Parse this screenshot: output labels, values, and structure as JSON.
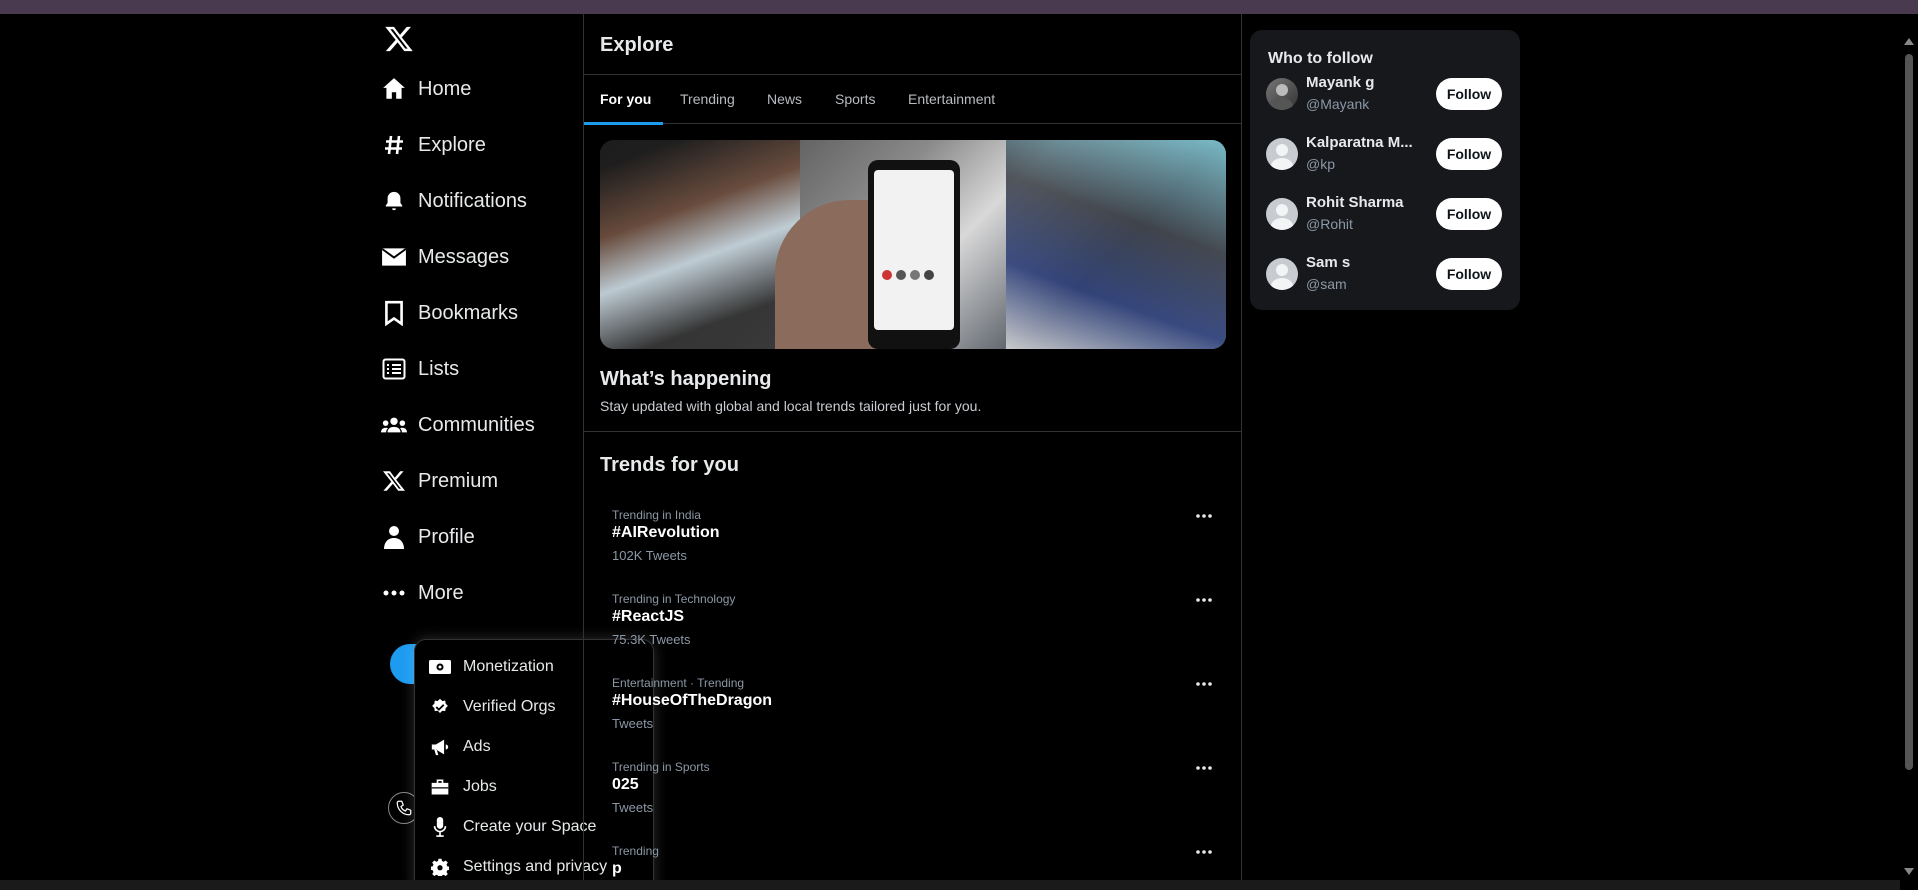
{
  "sidebar": {
    "items": [
      {
        "label": "Home",
        "icon": "home-icon"
      },
      {
        "label": "Explore",
        "icon": "hashtag-icon"
      },
      {
        "label": "Notifications",
        "icon": "bell-icon"
      },
      {
        "label": "Messages",
        "icon": "envelope-icon"
      },
      {
        "label": "Bookmarks",
        "icon": "bookmark-icon"
      },
      {
        "label": "Lists",
        "icon": "list-icon"
      },
      {
        "label": "Communities",
        "icon": "users-icon"
      },
      {
        "label": "Premium",
        "icon": "x-logo-icon"
      },
      {
        "label": "Profile",
        "icon": "user-icon"
      },
      {
        "label": "More",
        "icon": "ellipsis-icon"
      }
    ]
  },
  "more_menu": {
    "items": [
      {
        "label": "Monetization",
        "icon": "money-icon"
      },
      {
        "label": "Verified Orgs",
        "icon": "verified-icon"
      },
      {
        "label": "Ads",
        "icon": "megaphone-icon"
      },
      {
        "label": "Jobs",
        "icon": "briefcase-icon"
      },
      {
        "label": "Create your Space",
        "icon": "microphone-icon"
      },
      {
        "label": "Settings and privacy",
        "icon": "gear-icon"
      }
    ]
  },
  "main": {
    "title": "Explore",
    "tabs": [
      {
        "label": "For you"
      },
      {
        "label": "Trending"
      },
      {
        "label": "News"
      },
      {
        "label": "Sports"
      },
      {
        "label": "Entertainment"
      }
    ],
    "whats_happening": {
      "title": "What’s happening",
      "subtitle": "Stay updated with global and local trends tailored just for you."
    },
    "trends_title": "Trends for you",
    "trends": [
      {
        "context": "Trending in India",
        "tag": "#AIRevolution",
        "count": "102K Tweets"
      },
      {
        "context": "Trending in Technology",
        "tag": "#ReactJS",
        "count": "75.3K Tweets"
      },
      {
        "context": "Entertainment · Trending",
        "tag": "#HouseOfTheDragon",
        "count": "Tweets"
      },
      {
        "context": "Trending in Sports",
        "tag": "025",
        "count": "Tweets"
      },
      {
        "context": "Trending",
        "tag": "p",
        "count": ""
      }
    ]
  },
  "who_to_follow": {
    "title": "Who to follow",
    "follow_label": "Follow",
    "users": [
      {
        "name": "Mayank g",
        "handle": "@Mayank"
      },
      {
        "name": "Kalparatna M...",
        "handle": "@kp"
      },
      {
        "name": "Rohit Sharma",
        "handle": "@Rohit"
      },
      {
        "name": "Sam s",
        "handle": "@sam"
      }
    ]
  },
  "colors": {
    "accent": "#1d9bf0",
    "background": "#000000",
    "panel": "#16181c"
  }
}
